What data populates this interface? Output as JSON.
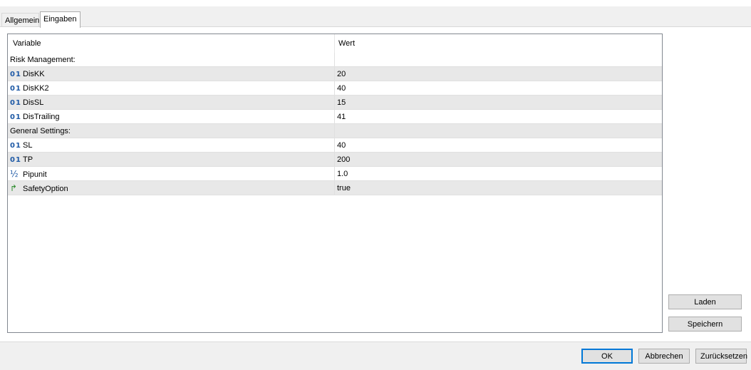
{
  "tabs": [
    {
      "label": "Allgemein",
      "selected": false
    },
    {
      "label": "Eingaben",
      "selected": true
    }
  ],
  "grid": {
    "headers": {
      "variable": "Variable",
      "value": "Wert"
    },
    "rows": [
      {
        "kind": "section",
        "label": "Risk Management:",
        "value": ""
      },
      {
        "kind": "param",
        "icon": "int-type-icon",
        "icon_text": "01",
        "label": "DisKK",
        "value": "20"
      },
      {
        "kind": "param",
        "icon": "int-type-icon",
        "icon_text": "01",
        "label": "DisKK2",
        "value": "40"
      },
      {
        "kind": "param",
        "icon": "int-type-icon",
        "icon_text": "01",
        "label": "DisSL",
        "value": "15"
      },
      {
        "kind": "param",
        "icon": "int-type-icon",
        "icon_text": "01",
        "label": "DisTrailing",
        "value": "41"
      },
      {
        "kind": "section",
        "label": "General Settings:",
        "value": ""
      },
      {
        "kind": "param",
        "icon": "int-type-icon",
        "icon_text": "01",
        "label": "SL",
        "value": "40"
      },
      {
        "kind": "param",
        "icon": "int-type-icon",
        "icon_text": "01",
        "label": "TP",
        "value": "200"
      },
      {
        "kind": "param",
        "icon": "double-type-icon",
        "icon_text": "½",
        "label": "Pipunit",
        "value": "1.0"
      },
      {
        "kind": "param",
        "icon": "bool-type-icon",
        "icon_text": "↱",
        "label": "SafetyOption",
        "value": "true"
      }
    ]
  },
  "side_buttons": {
    "load": "Laden",
    "save": "Speichern"
  },
  "footer_buttons": {
    "ok": "OK",
    "cancel": "Abbrechen",
    "reset": "Zurücksetzen"
  },
  "colors": {
    "accent": "#0078d7",
    "int_icon": "#1f5aa6",
    "bool_icon": "#2b8a2b"
  }
}
